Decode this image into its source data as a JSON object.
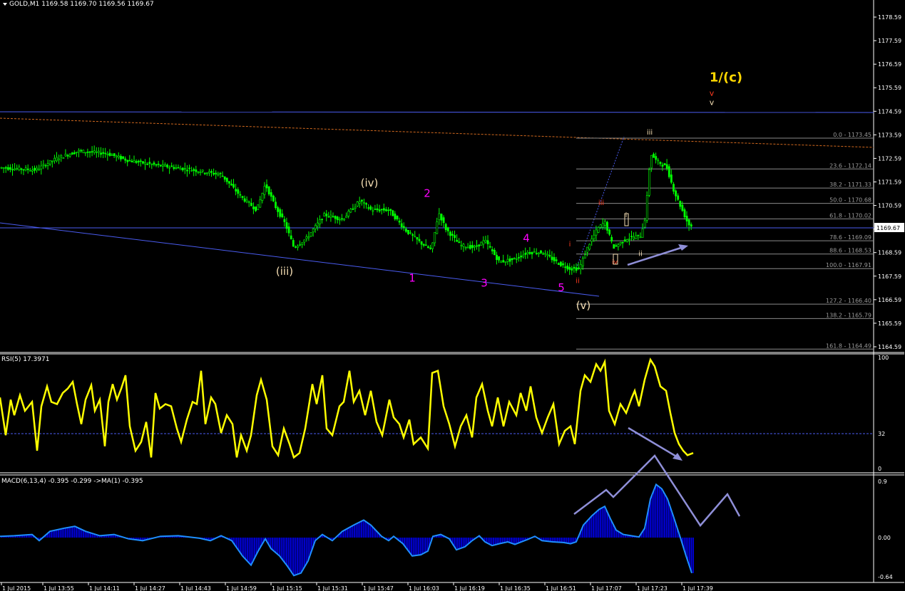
{
  "header": {
    "main": "GOLD,M1  1169.58 1169.70 1169.56 1169.67",
    "rsi": "RSI(5) 17.3971",
    "macd": "MACD(6,13,4) -0.395 -0.299  ->MA(1) -0.395"
  },
  "colors": {
    "background": "#000000",
    "candles": "#00ff00",
    "rsi": "#ffff00",
    "macd_hist": "#0000ff",
    "macd_line": "#1e90ff",
    "trendline": "#4a5cf0",
    "resistance_dashed": "#d2691e",
    "fib_lines": "#8a8a8a",
    "arrows": "#8f8fd8",
    "magenta": "#ff00ff",
    "tan": "#f5deb3",
    "yellow": "#ffd700",
    "red": "#ff3b1f"
  },
  "chart_data": [
    {
      "type": "candlestick",
      "symbol": "GOLD,M1",
      "ohlc_last": {
        "open": 1169.58,
        "high": 1169.7,
        "low": 1169.56,
        "close": 1169.67
      },
      "current_price_label": "1169.67",
      "ylim": [
        1164.2,
        1179.2
      ],
      "yticks": [
        "1178.59",
        "1177.59",
        "1176.59",
        "1175.59",
        "1174.59",
        "1173.59",
        "1172.59",
        "1171.59",
        "1170.59",
        "1169.59",
        "1168.59",
        "1167.59",
        "1166.59",
        "1165.59",
        "1164.59"
      ],
      "xticks": [
        "1 Jul 2015",
        "1 Jul 13:55",
        "1 Jul 14:11",
        "1 Jul 14:27",
        "1 Jul 14:43",
        "1 Jul 14:59",
        "1 Jul 15:15",
        "1 Jul 15:31",
        "1 Jul 15:47",
        "1 Jul 16:03",
        "1 Jul 16:19",
        "1 Jul 16:35",
        "1 Jul 16:51",
        "1 Jul 17:07",
        "1 Jul 17:23",
        "1 Jul 17:39"
      ],
      "price_path": [
        [
          0,
          1172.2
        ],
        [
          50,
          1172.1
        ],
        [
          80,
          1172.6
        ],
        [
          110,
          1172.9
        ],
        [
          150,
          1172.8
        ],
        [
          180,
          1172.5
        ],
        [
          220,
          1172.3
        ],
        [
          270,
          1172.1
        ],
        [
          310,
          1171.9
        ],
        [
          340,
          1170.9
        ],
        [
          360,
          1170.4
        ],
        [
          372,
          1171.5
        ],
        [
          385,
          1170.6
        ],
        [
          400,
          1169.8
        ],
        [
          412,
          1168.8
        ],
        [
          430,
          1169.2
        ],
        [
          455,
          1170.2
        ],
        [
          480,
          1170.0
        ],
        [
          505,
          1170.8
        ],
        [
          520,
          1170.4
        ],
        [
          545,
          1170.4
        ],
        [
          570,
          1169.5
        ],
        [
          590,
          1169.0
        ],
        [
          605,
          1168.7
        ],
        [
          615,
          1170.3
        ],
        [
          625,
          1169.6
        ],
        [
          645,
          1168.9
        ],
        [
          665,
          1168.8
        ],
        [
          680,
          1169.1
        ],
        [
          700,
          1168.2
        ],
        [
          720,
          1168.3
        ],
        [
          740,
          1168.6
        ],
        [
          760,
          1168.6
        ],
        [
          785,
          1168.1
        ],
        [
          800,
          1167.9
        ],
        [
          812,
          1167.9
        ],
        [
          825,
          1168.9
        ],
        [
          838,
          1169.6
        ],
        [
          848,
          1169.9
        ],
        [
          860,
          1168.8
        ],
        [
          880,
          1169.2
        ],
        [
          898,
          1169.3
        ],
        [
          905,
          1170.1
        ],
        [
          912,
          1172.8
        ],
        [
          920,
          1172.5
        ],
        [
          935,
          1172.2
        ],
        [
          945,
          1171.2
        ],
        [
          955,
          1170.5
        ],
        [
          965,
          1169.8
        ],
        [
          972,
          1169.67
        ]
      ],
      "fib_levels": [
        {
          "pct": "0.0",
          "price": 1173.45,
          "label": "0.0 - 1173.45"
        },
        {
          "pct": "23.6",
          "price": 1172.14,
          "label": "23.6 - 1172.14"
        },
        {
          "pct": "38.2",
          "price": 1171.33,
          "label": "38.2 - 1171.33"
        },
        {
          "pct": "50.0",
          "price": 1170.68,
          "label": "50.0 - 1170.68"
        },
        {
          "pct": "61.8",
          "price": 1170.02,
          "label": "61.8 - 1170.02"
        },
        {
          "pct": "78.6",
          "price": 1169.09,
          "label": "78.6 - 1169.09"
        },
        {
          "pct": "88.6",
          "price": 1168.53,
          "label": "88.6 - 1168.53"
        },
        {
          "pct": "100.0",
          "price": 1167.91,
          "label": "100.0 - 1167.91"
        },
        {
          "pct": "127.2",
          "price": 1166.4,
          "label": "127.2 - 1166.40"
        },
        {
          "pct": "138.2",
          "price": 1165.79,
          "label": "138.2 - 1165.79"
        },
        {
          "pct": "161.8",
          "price": 1164.49,
          "label": "161.8 - 1164.49"
        }
      ],
      "wave_labels": [
        {
          "text": "(iii)",
          "x": 399,
          "price": 1167.65,
          "color": "tan",
          "size": 15
        },
        {
          "text": "(iv)",
          "x": 518,
          "price": 1171.4,
          "color": "tan",
          "size": 15
        },
        {
          "text": "(v)",
          "x": 818,
          "price": 1166.2,
          "color": "tan",
          "size": 15
        },
        {
          "text": "1",
          "x": 578,
          "price": 1167.35,
          "color": "magenta",
          "size": 15
        },
        {
          "text": "2",
          "x": 599,
          "price": 1170.95,
          "color": "magenta",
          "size": 15
        },
        {
          "text": "3",
          "x": 679,
          "price": 1167.15,
          "color": "magenta",
          "size": 15
        },
        {
          "text": "4",
          "x": 738,
          "price": 1169.05,
          "color": "magenta",
          "size": 15
        },
        {
          "text": "5",
          "x": 787,
          "price": 1166.95,
          "color": "magenta",
          "size": 15
        },
        {
          "text": "1/(c)",
          "x": 1018,
          "price": 1175.85,
          "color": "yellow",
          "size": 18
        },
        {
          "text": "v",
          "x": 998,
          "price": 1175.25,
          "color": "red",
          "size": 11
        },
        {
          "text": "v",
          "x": 998,
          "price": 1174.85,
          "color": "tan",
          "size": 11
        },
        {
          "text": "iii",
          "x": 911,
          "price": 1173.6,
          "color": "tan",
          "size": 10
        },
        {
          "text": "iii",
          "x": 843,
          "price": 1170.6,
          "color": "red",
          "size": 10
        },
        {
          "text": "i",
          "x": 799,
          "price": 1168.85,
          "color": "red",
          "size": 10
        },
        {
          "text": "ii",
          "x": 810,
          "price": 1167.3,
          "color": "red",
          "size": 10
        },
        {
          "text": "ii",
          "x": 898,
          "price": 1168.45,
          "color": "tan",
          "size": 10
        },
        {
          "text": "iv",
          "x": 862,
          "price": 1168.1,
          "color": "red",
          "size": 9
        },
        {
          "text": "i",
          "x": 878,
          "price": 1170.1,
          "color": "tan",
          "size": 9
        }
      ]
    },
    {
      "type": "line",
      "name": "RSI(5)",
      "value": 17.3971,
      "ylim": [
        0,
        100
      ],
      "yticks": [
        "100",
        "32",
        "0"
      ],
      "level": 32,
      "points": [
        [
          0,
          64
        ],
        [
          8,
          30
        ],
        [
          15,
          62
        ],
        [
          20,
          48
        ],
        [
          28,
          66
        ],
        [
          35,
          52
        ],
        [
          45,
          60
        ],
        [
          52,
          16
        ],
        [
          58,
          56
        ],
        [
          66,
          74
        ],
        [
          72,
          60
        ],
        [
          80,
          58
        ],
        [
          88,
          68
        ],
        [
          95,
          72
        ],
        [
          102,
          78
        ],
        [
          108,
          58
        ],
        [
          114,
          40
        ],
        [
          120,
          62
        ],
        [
          128,
          75
        ],
        [
          133,
          52
        ],
        [
          140,
          62
        ],
        [
          147,
          20
        ],
        [
          152,
          60
        ],
        [
          158,
          76
        ],
        [
          164,
          62
        ],
        [
          170,
          72
        ],
        [
          176,
          84
        ],
        [
          182,
          38
        ],
        [
          190,
          16
        ],
        [
          198,
          24
        ],
        [
          205,
          42
        ],
        [
          212,
          10
        ],
        [
          218,
          68
        ],
        [
          224,
          54
        ],
        [
          232,
          58
        ],
        [
          240,
          56
        ],
        [
          248,
          36
        ],
        [
          254,
          24
        ],
        [
          262,
          44
        ],
        [
          270,
          60
        ],
        [
          276,
          58
        ],
        [
          282,
          88
        ],
        [
          288,
          40
        ],
        [
          296,
          64
        ],
        [
          302,
          58
        ],
        [
          310,
          32
        ],
        [
          318,
          48
        ],
        [
          326,
          40
        ],
        [
          332,
          10
        ],
        [
          338,
          30
        ],
        [
          346,
          16
        ],
        [
          352,
          30
        ],
        [
          360,
          66
        ],
        [
          366,
          80
        ],
        [
          374,
          62
        ],
        [
          382,
          20
        ],
        [
          390,
          12
        ],
        [
          398,
          36
        ],
        [
          406,
          22
        ],
        [
          412,
          10
        ],
        [
          420,
          14
        ],
        [
          428,
          36
        ],
        [
          438,
          76
        ],
        [
          444,
          58
        ],
        [
          452,
          84
        ],
        [
          458,
          36
        ],
        [
          466,
          30
        ],
        [
          476,
          56
        ],
        [
          482,
          60
        ],
        [
          490,
          88
        ],
        [
          496,
          60
        ],
        [
          504,
          70
        ],
        [
          512,
          48
        ],
        [
          520,
          70
        ],
        [
          528,
          42
        ],
        [
          536,
          30
        ],
        [
          546,
          62
        ],
        [
          552,
          46
        ],
        [
          560,
          40
        ],
        [
          566,
          28
        ],
        [
          574,
          44
        ],
        [
          580,
          22
        ],
        [
          590,
          28
        ],
        [
          600,
          18
        ],
        [
          606,
          86
        ],
        [
          614,
          88
        ],
        [
          622,
          56
        ],
        [
          630,
          40
        ],
        [
          638,
          20
        ],
        [
          646,
          38
        ],
        [
          654,
          48
        ],
        [
          662,
          28
        ],
        [
          668,
          64
        ],
        [
          676,
          76
        ],
        [
          684,
          52
        ],
        [
          690,
          38
        ],
        [
          698,
          64
        ],
        [
          706,
          38
        ],
        [
          714,
          60
        ],
        [
          724,
          48
        ],
        [
          730,
          68
        ],
        [
          738,
          52
        ],
        [
          744,
          74
        ],
        [
          752,
          46
        ],
        [
          760,
          32
        ],
        [
          768,
          46
        ],
        [
          776,
          58
        ],
        [
          784,
          22
        ],
        [
          792,
          34
        ],
        [
          800,
          38
        ],
        [
          806,
          22
        ],
        [
          814,
          70
        ],
        [
          820,
          84
        ],
        [
          828,
          78
        ],
        [
          836,
          94
        ],
        [
          842,
          88
        ],
        [
          848,
          96
        ],
        [
          854,
          52
        ],
        [
          862,
          40
        ],
        [
          870,
          58
        ],
        [
          878,
          50
        ],
        [
          886,
          64
        ],
        [
          890,
          70
        ],
        [
          896,
          56
        ],
        [
          904,
          80
        ],
        [
          912,
          98
        ],
        [
          918,
          92
        ],
        [
          926,
          74
        ],
        [
          934,
          70
        ],
        [
          940,
          50
        ],
        [
          946,
          32
        ],
        [
          952,
          22
        ],
        [
          958,
          16
        ],
        [
          964,
          12
        ],
        [
          972,
          14
        ]
      ]
    },
    {
      "type": "histogram",
      "name": "MACD(6,13,4)",
      "macd": -0.395,
      "signal": -0.299,
      "ma1": -0.395,
      "ylim": [
        -0.64,
        0.9
      ],
      "yticks": [
        "0.9",
        "0.00",
        "-0.64"
      ],
      "points": [
        [
          0,
          0.02
        ],
        [
          20,
          0.03
        ],
        [
          45,
          0.05
        ],
        [
          55,
          -0.05
        ],
        [
          70,
          0.1
        ],
        [
          90,
          0.15
        ],
        [
          105,
          0.18
        ],
        [
          120,
          0.1
        ],
        [
          140,
          0.03
        ],
        [
          160,
          0.05
        ],
        [
          180,
          -0.02
        ],
        [
          200,
          -0.05
        ],
        [
          225,
          0.02
        ],
        [
          250,
          0.03
        ],
        [
          280,
          -0.01
        ],
        [
          295,
          -0.05
        ],
        [
          310,
          0.03
        ],
        [
          325,
          -0.05
        ],
        [
          340,
          -0.3
        ],
        [
          352,
          -0.45
        ],
        [
          362,
          -0.22
        ],
        [
          372,
          -0.02
        ],
        [
          380,
          -0.18
        ],
        [
          392,
          -0.3
        ],
        [
          402,
          -0.45
        ],
        [
          412,
          -0.62
        ],
        [
          422,
          -0.58
        ],
        [
          432,
          -0.38
        ],
        [
          442,
          -0.05
        ],
        [
          452,
          0.05
        ],
        [
          466,
          -0.05
        ],
        [
          480,
          0.1
        ],
        [
          496,
          0.2
        ],
        [
          510,
          0.28
        ],
        [
          520,
          0.2
        ],
        [
          535,
          0.02
        ],
        [
          545,
          -0.05
        ],
        [
          552,
          0.02
        ],
        [
          565,
          -0.1
        ],
        [
          578,
          -0.3
        ],
        [
          590,
          -0.28
        ],
        [
          600,
          -0.22
        ],
        [
          607,
          0.02
        ],
        [
          618,
          0.05
        ],
        [
          630,
          -0.02
        ],
        [
          640,
          -0.2
        ],
        [
          652,
          -0.15
        ],
        [
          662,
          -0.05
        ],
        [
          672,
          0.03
        ],
        [
          680,
          -0.07
        ],
        [
          690,
          -0.13
        ],
        [
          700,
          -0.1
        ],
        [
          712,
          -0.07
        ],
        [
          722,
          -0.11
        ],
        [
          740,
          -0.03
        ],
        [
          750,
          0.02
        ],
        [
          760,
          -0.05
        ],
        [
          775,
          -0.07
        ],
        [
          790,
          -0.08
        ],
        [
          800,
          -0.1
        ],
        [
          808,
          -0.07
        ],
        [
          818,
          0.2
        ],
        [
          830,
          0.35
        ],
        [
          840,
          0.45
        ],
        [
          848,
          0.5
        ],
        [
          856,
          0.3
        ],
        [
          864,
          0.12
        ],
        [
          874,
          0.05
        ],
        [
          885,
          0.03
        ],
        [
          896,
          0.01
        ],
        [
          904,
          0.15
        ],
        [
          912,
          0.62
        ],
        [
          920,
          0.85
        ],
        [
          928,
          0.78
        ],
        [
          936,
          0.62
        ],
        [
          944,
          0.35
        ],
        [
          954,
          0.0
        ],
        [
          962,
          -0.3
        ],
        [
          970,
          -0.58
        ]
      ]
    }
  ]
}
